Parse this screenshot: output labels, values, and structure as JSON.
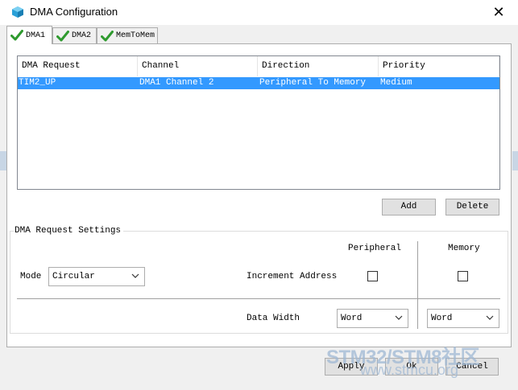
{
  "window": {
    "title": "DMA Configuration",
    "close_glyph": "✕"
  },
  "tabs": [
    {
      "label": "DMA1",
      "active": true,
      "icon": "check-icon"
    },
    {
      "label": "DMA2",
      "active": false,
      "icon": "check-icon"
    },
    {
      "label": "MemToMem",
      "active": false,
      "icon": "check-icon"
    }
  ],
  "table": {
    "columns": [
      "DMA Request",
      "Channel",
      "Direction",
      "Priority"
    ],
    "rows": [
      [
        "TIM2_UP",
        "DMA1 Channel 2",
        "Peripheral To Memory",
        "Medium"
      ]
    ],
    "selected_row": 0
  },
  "buttons": {
    "add": "Add",
    "delete": "Delete",
    "apply": "Apply",
    "ok": "Ok",
    "cancel": "Cancel"
  },
  "settings": {
    "group_label": "DMA Request Settings",
    "peripheral_header": "Peripheral",
    "memory_header": "Memory",
    "mode_label": "Mode",
    "mode_value": "Circular",
    "increment_label": "Increment Address",
    "peripheral_increment": false,
    "memory_increment": false,
    "data_width_label": "Data Width",
    "peripheral_width": "Word",
    "memory_width": "Word"
  },
  "watermark": {
    "line1": "STM32/STM8社区",
    "line2": "www.stmcu.org"
  },
  "colors": {
    "selection": "#3399ff",
    "check": "#2e9a2e",
    "window_bg": "#f0f0f0",
    "watermark": "#9fb8d4"
  }
}
